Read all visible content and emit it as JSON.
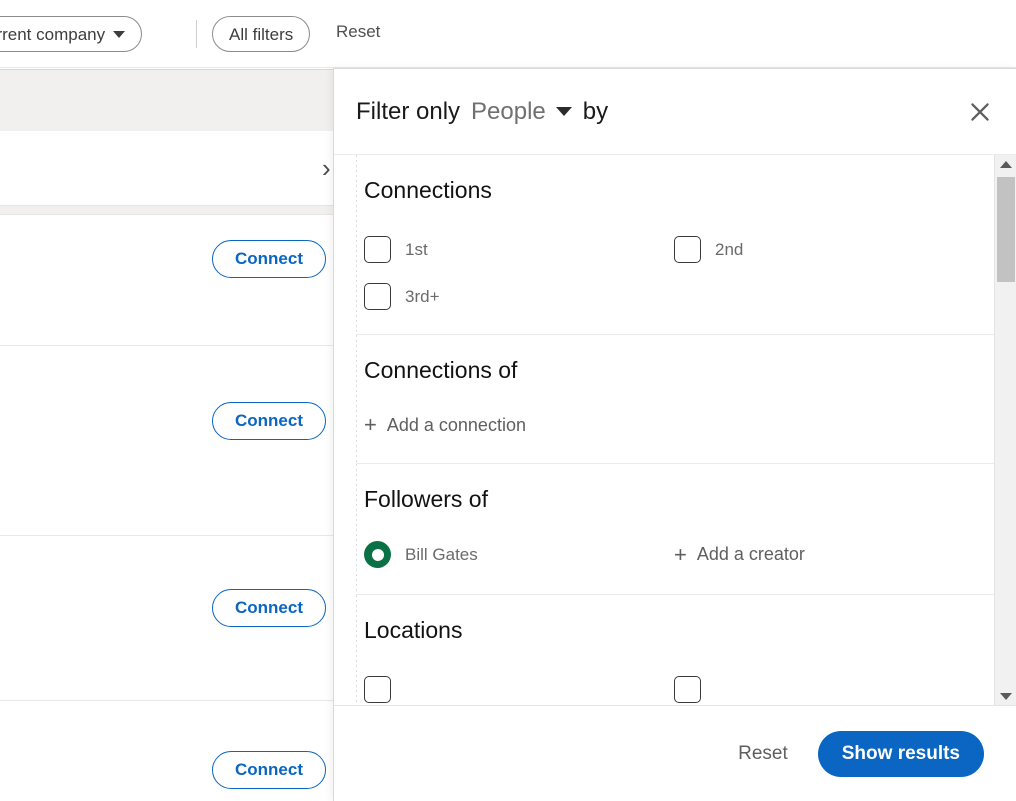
{
  "filter_bar": {
    "current_company_label": "urrent company",
    "all_filters_label": "All filters",
    "reset_label": "Reset"
  },
  "background": {
    "connect_label": "Connect",
    "connect_buttons": [
      "Connect",
      "Connect",
      "Connect",
      "Connect"
    ],
    "chevron_glyph": "›"
  },
  "modal": {
    "title_prefix": "Filter only",
    "entity": "People",
    "title_suffix": "by",
    "close_icon": "close-icon",
    "sections": [
      {
        "id": "connections",
        "title": "Connections",
        "type": "checkbox-grid",
        "options": [
          {
            "label": "1st",
            "checked": false
          },
          {
            "label": "2nd",
            "checked": false
          },
          {
            "label": "3rd+",
            "checked": false
          }
        ]
      },
      {
        "id": "connections-of",
        "title": "Connections of",
        "type": "add-link",
        "add_label": "Add a connection",
        "plus": "+"
      },
      {
        "id": "followers-of",
        "title": "Followers of",
        "type": "creator",
        "creator_name": "Bill Gates",
        "add_label": "Add a creator",
        "plus": "+"
      },
      {
        "id": "locations",
        "title": "Locations",
        "type": "checkbox-grid-partial",
        "options": [
          {
            "label": "",
            "checked": false
          },
          {
            "label": "",
            "checked": false
          }
        ]
      }
    ],
    "footer": {
      "reset_label": "Reset",
      "show_results_label": "Show results"
    }
  },
  "colors": {
    "brand_blue": "#0a66c2",
    "ring_green": "#0a7045",
    "text_dark": "#1a1a1a",
    "text_muted": "#6b6b6b",
    "divider": "#ebebeb"
  }
}
